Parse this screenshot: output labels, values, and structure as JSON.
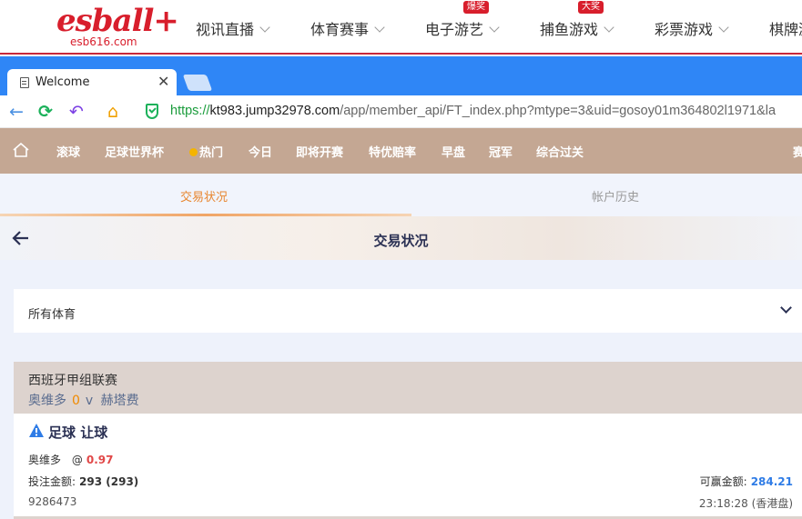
{
  "site": {
    "logo_text": "esball+",
    "logo_domain": "esb616.com",
    "nav": [
      {
        "label": "视讯直播",
        "badge": ""
      },
      {
        "label": "体育赛事",
        "badge": ""
      },
      {
        "label": "电子游艺",
        "badge": "爆奖"
      },
      {
        "label": "捕鱼游戏",
        "badge": "大奖"
      },
      {
        "label": "彩票游戏",
        "badge": ""
      },
      {
        "label": "棋牌游"
      }
    ]
  },
  "browser": {
    "tab_title": "Welcome",
    "url_proto": "https://",
    "url_host": "kt983.jump32978.com",
    "url_path": "/app/member_api/FT_index.php?mtype=3&uid=gosoy01m364802l1971&la"
  },
  "sport_menu": {
    "items": [
      "滚球",
      "足球世界杯",
      "热门",
      "今日",
      "即将开赛",
      "特优赔率",
      "早盘",
      "冠军",
      "综合过关",
      "赛"
    ]
  },
  "subtabs": {
    "active": "交易状况",
    "inactive": "帐户历史"
  },
  "header": {
    "title": "交易状况"
  },
  "filter": {
    "selected": "所有体育"
  },
  "bet": {
    "league": "西班牙甲组联赛",
    "home": "奥维多",
    "score": "0",
    "vs": "v",
    "away": "赫塔费",
    "bet_type": "足球 让球",
    "pick": "奥维多",
    "at": "@",
    "odds": "0.97",
    "stake_label": "投注金额:",
    "stake_value": "293 (293)",
    "win_label": "可赢金额:",
    "win_value": "284.21",
    "ticket_id": "9286473",
    "time": "23:18:28 (香港盘)"
  },
  "colors": {
    "brand_red": "#d81e2c",
    "browser_blue": "#2f86f6",
    "sport_bar": "#c4a793",
    "active_tab": "#e8862f",
    "odds_red": "#e14848",
    "win_blue": "#2f7ce6"
  }
}
